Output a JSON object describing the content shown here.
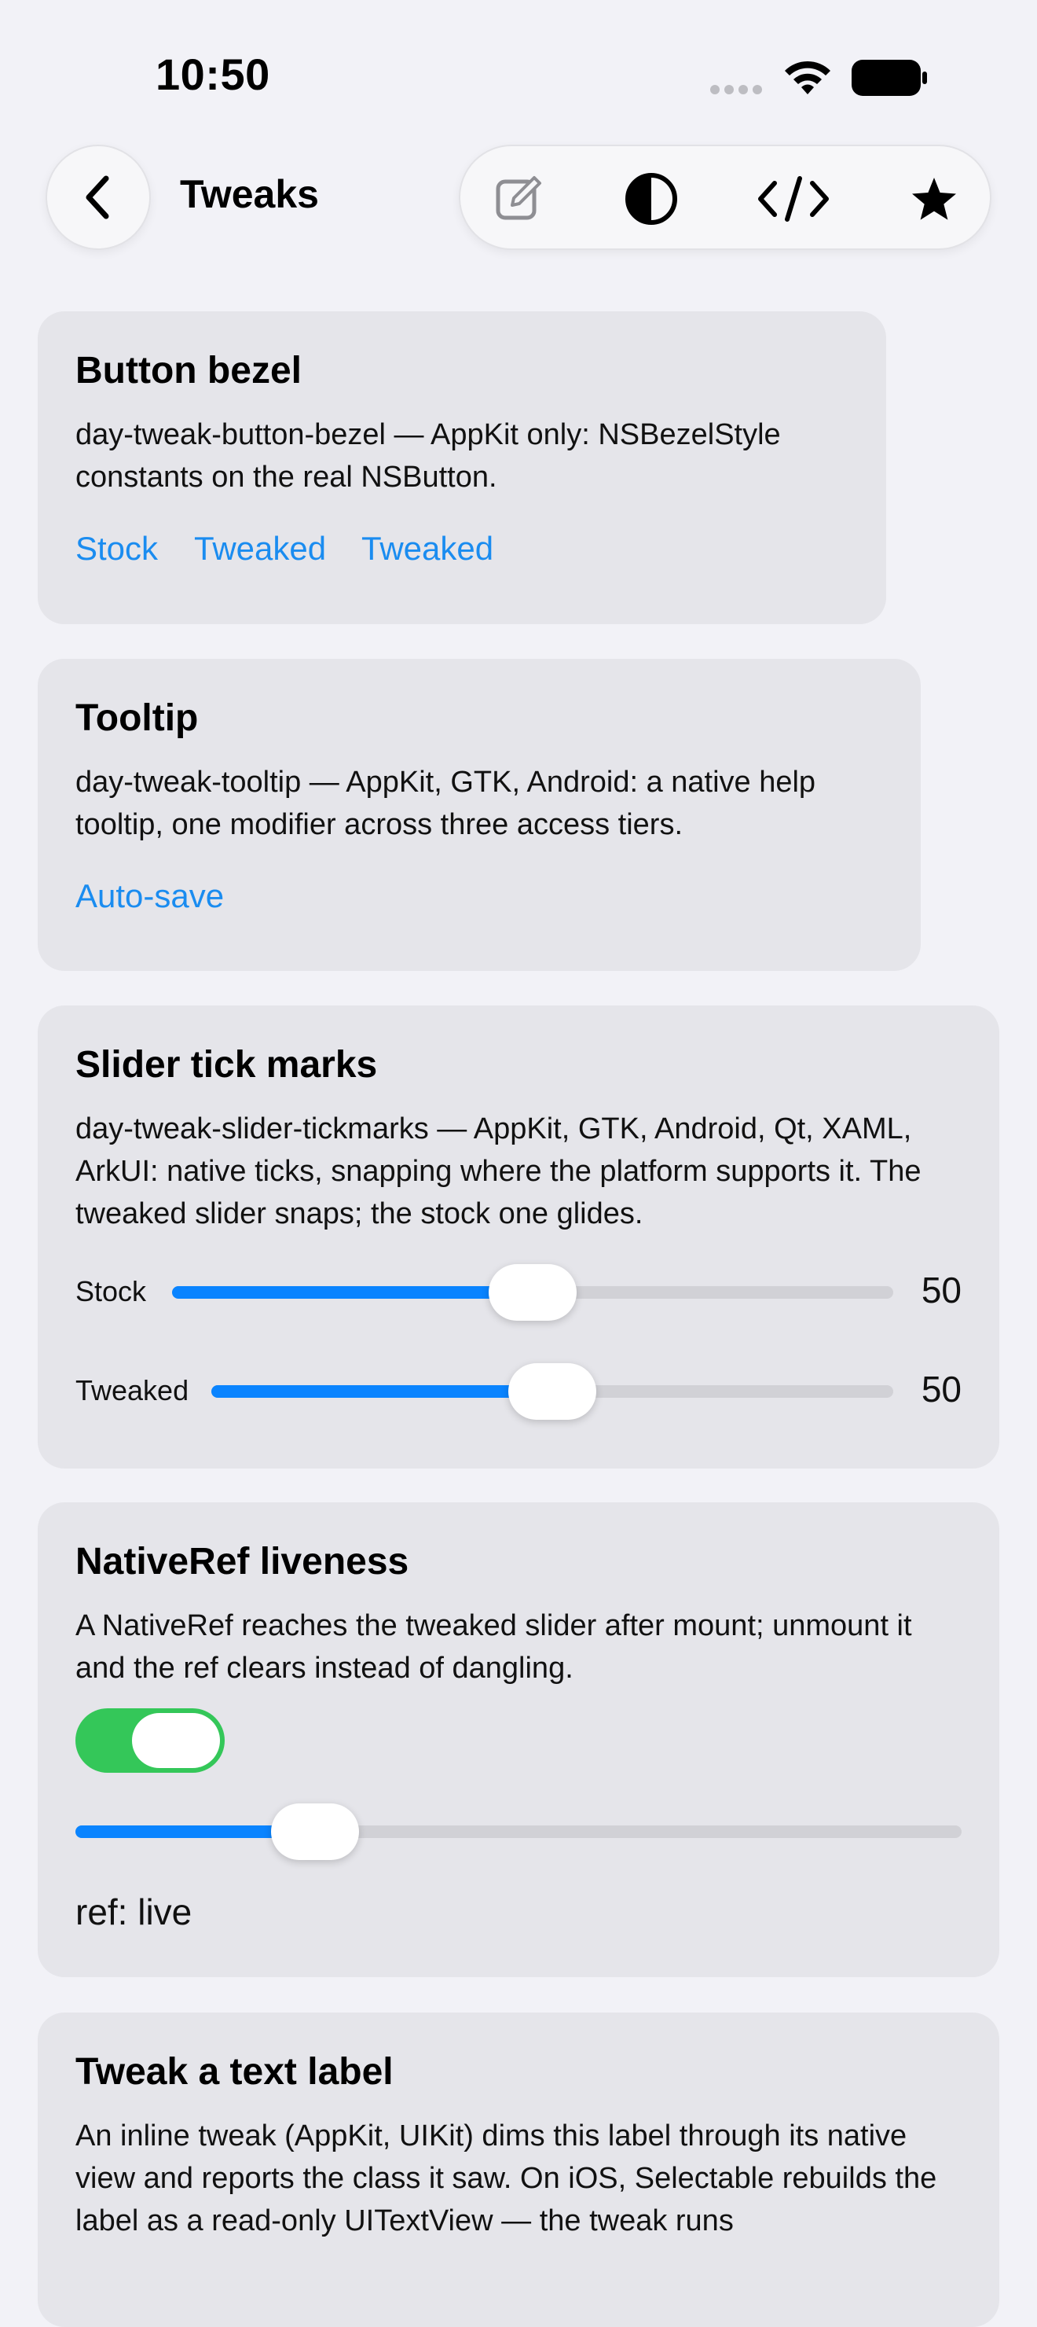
{
  "status_bar": {
    "time": "10:50"
  },
  "nav": {
    "title": "Tweaks"
  },
  "toolbar": {
    "icons": [
      "compose-icon",
      "contrast-icon",
      "code-icon",
      "star-icon"
    ]
  },
  "cards": {
    "bezel": {
      "title": "Button bezel",
      "desc": "day-tweak-button-bezel — AppKit only: NSBezelStyle constants on the real NSButton.",
      "buttons": [
        "Stock",
        "Tweaked",
        "Tweaked"
      ]
    },
    "tooltip": {
      "title": "Tooltip",
      "desc": "day-tweak-tooltip — AppKit, GTK, Android: a native help tooltip, one modifier across three access tiers.",
      "button": "Auto-save"
    },
    "slider_ticks": {
      "title": "Slider tick marks",
      "desc": "day-tweak-slider-tickmarks — AppKit, GTK, Android, Qt, XAML, ArkUI: native ticks, snapping where the platform supports it. The tweaked slider snaps; the stock one glides.",
      "sliders": [
        {
          "label": "Stock",
          "value": "50",
          "fraction": 0.5
        },
        {
          "label": "Tweaked",
          "value": "50",
          "fraction": 0.5
        }
      ]
    },
    "nativeref": {
      "title": "NativeRef liveness",
      "desc": "A NativeRef reaches the tweaked slider after mount; unmount it and the ref clears instead of dangling.",
      "toggle_on": true,
      "slider_fraction": 0.27,
      "ref_text": "ref: live"
    },
    "text_label": {
      "title": "Tweak a text label",
      "desc": "An inline tweak (AppKit, UIKit) dims this label through its native view and reports the class it saw. On iOS, Selectable rebuilds the label as a read-only UITextView — the tweak runs"
    }
  },
  "colors": {
    "accent": "#0a84ff",
    "link": "#1a8cf0",
    "toggle_on": "#34c759",
    "card_bg": "#e5e5ea",
    "page_bg": "#f2f2f7"
  }
}
